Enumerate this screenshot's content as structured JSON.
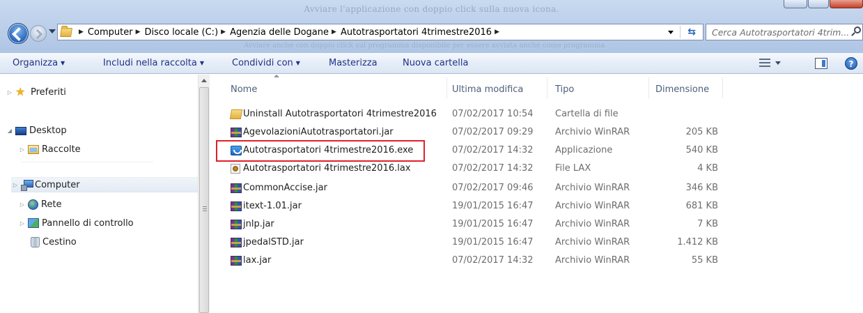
{
  "window": {
    "title_faint": "Avviare l'applicazione con doppio click sulla nuova icona.",
    "title_faint2": "Avviare anche con doppio click sul programma disponibile per essere avviata anche come programma"
  },
  "address": {
    "crumbs": [
      "Computer",
      "Disco locale (C:)",
      "Agenzia delle Dogane",
      "Autotrasportatori 4trimestre2016"
    ],
    "search_placeholder": "Cerca Autotrasportatori 4trim..."
  },
  "toolbar": {
    "organizza": "Organizza",
    "includi": "Includi nella raccolta",
    "condividi": "Condividi con",
    "masterizza": "Masterizza",
    "nuova_cartella": "Nuova cartella",
    "help": "?"
  },
  "sidebar": {
    "preferiti": "Preferiti",
    "desktop": "Desktop",
    "raccolte": "Raccolte",
    "computer": "Computer",
    "rete": "Rete",
    "pannello": "Pannello di controllo",
    "cestino": "Cestino"
  },
  "columns": {
    "name": "Nome",
    "modified": "Ultima modifica",
    "type": "Tipo",
    "size": "Dimensione"
  },
  "files": [
    {
      "name": "Uninstall Autotrasportatori 4trimestre2016",
      "date": "07/02/2017 10:54",
      "type": "Cartella di file",
      "size": "",
      "icon": "folder-icon"
    },
    {
      "name": "AgevolazioniAutotrasportatori.jar",
      "date": "07/02/2017 09:29",
      "type": "Archivio WinRAR",
      "size": "205 KB",
      "icon": "winrar-icon"
    },
    {
      "name": "Autotrasportatori 4trimestre2016.exe",
      "date": "07/02/2017 14:32",
      "type": "Applicazione",
      "size": "540 KB",
      "icon": "application-icon"
    },
    {
      "name": "Autotrasportatori 4trimestre2016.lax",
      "date": "07/02/2017 14:32",
      "type": "File LAX",
      "size": "4 KB",
      "icon": "lax-file-icon"
    },
    {
      "name": "CommonAccise.jar",
      "date": "07/02/2017 09:46",
      "type": "Archivio WinRAR",
      "size": "346 KB",
      "icon": "winrar-icon"
    },
    {
      "name": "itext-1.01.jar",
      "date": "19/01/2015 16:47",
      "type": "Archivio WinRAR",
      "size": "681 KB",
      "icon": "winrar-icon"
    },
    {
      "name": "jnlp.jar",
      "date": "19/01/2015 16:47",
      "type": "Archivio WinRAR",
      "size": "7 KB",
      "icon": "winrar-icon"
    },
    {
      "name": "jpedalSTD.jar",
      "date": "19/01/2015 16:47",
      "type": "Archivio WinRAR",
      "size": "1.412 KB",
      "icon": "winrar-icon"
    },
    {
      "name": "lax.jar",
      "date": "07/02/2017 14:32",
      "type": "Archivio WinRAR",
      "size": "55 KB",
      "icon": "winrar-icon"
    }
  ],
  "highlight": {
    "color": "#e0202a"
  }
}
